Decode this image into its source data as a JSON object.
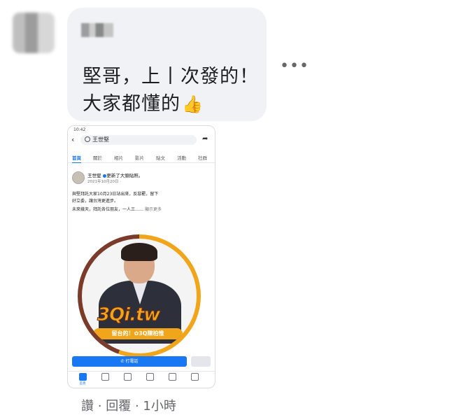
{
  "comment": {
    "text_line1": "堅哥，上丨次發的！",
    "text_line2": "大家都懂的",
    "more_icon": "ellipsis-icon",
    "actions": {
      "like": "讚",
      "sep1": "·",
      "reply": "回覆",
      "sep2": "·",
      "time": "1小時"
    }
  },
  "phone": {
    "status_left": "10:42",
    "search_text": "王世堅",
    "tabs": [
      "首頁",
      "關於",
      "相片",
      "影片",
      "貼文",
      "活動",
      "社群"
    ],
    "post": {
      "author": "王世堅",
      "action": "更新了大頭貼照。",
      "date": "2021年10月20日 · ",
      "lines": [
        "與堅拜託大家10月23日站出來，反惡罷，留下",
        "好立委，讓台灣更進步。",
        "未來幾天，拜託各位朋友，一人三……"
      ],
      "see_more": "顯示更多"
    },
    "image": {
      "logo_text": "3Qi.tw",
      "tagline": "留台的！✿3Q陳柏惟"
    },
    "call_button": "打電話",
    "nav": [
      "首頁",
      "",
      "",
      "",
      "",
      ""
    ]
  },
  "colors": {
    "accent": "#1877f2",
    "bubble": "#f0f2f5",
    "ring": "#f1a51b"
  }
}
